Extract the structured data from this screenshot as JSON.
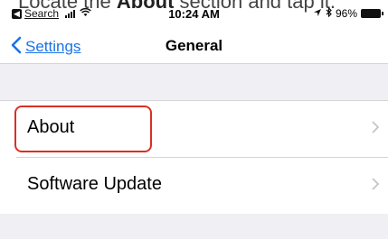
{
  "caption": {
    "prefix": "Locate the ",
    "bold": "About",
    "suffix": " section and tap it."
  },
  "status_bar": {
    "back_app_glyph": "◀",
    "back_app_label": "Search",
    "time": "10:24 AM",
    "battery": "96%",
    "icons": [
      "signal-icon",
      "wifi-icon",
      "location-icon",
      "bluetooth-icon",
      "battery-icon"
    ]
  },
  "nav": {
    "back_label": "Settings",
    "title": "General"
  },
  "list": {
    "items": [
      {
        "label": "About",
        "highlighted": true
      },
      {
        "label": "Software Update",
        "highlighted": false
      }
    ]
  },
  "colors": {
    "accent": "#1a73e8",
    "highlight": "#d93025",
    "grouped_bg": "#efeff4",
    "separator": "#d5d5d9"
  }
}
